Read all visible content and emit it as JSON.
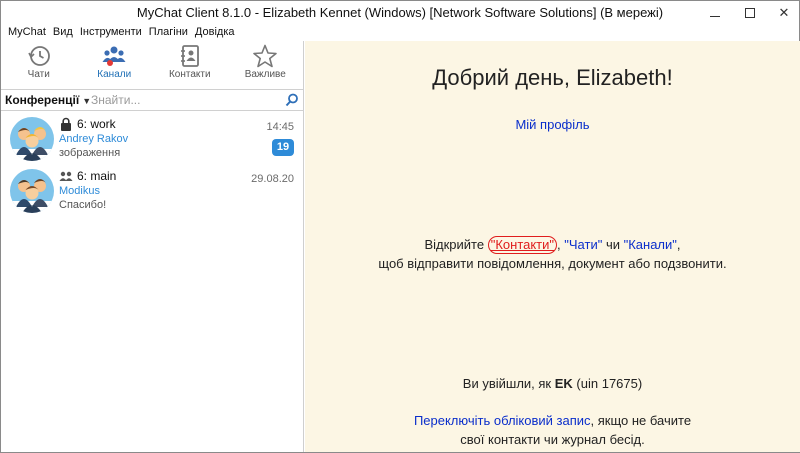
{
  "window": {
    "title": "MyChat Client 8.1.0 - Elizabeth Kennet (Windows) [Network Software Solutions] (В мережі)",
    "minimize_glyph": "—",
    "close_glyph": "✕"
  },
  "menu": [
    "MyChat",
    "Вид",
    "Інструменти",
    "Плагіни",
    "Довідка"
  ],
  "tabs": [
    {
      "label": "Чати",
      "icon": "history-icon",
      "active": false
    },
    {
      "label": "Канали",
      "icon": "channels-icon",
      "active": true
    },
    {
      "label": "Контакти",
      "icon": "contacts-icon",
      "active": false
    },
    {
      "label": "Важливе",
      "icon": "star-icon",
      "active": false
    }
  ],
  "filter": {
    "selected": "Конференції",
    "search_placeholder": "Знайти..."
  },
  "chats": [
    {
      "title": "6: work",
      "author": "Andrey Rakov",
      "message": "зображення",
      "time": "14:45",
      "unread": "19",
      "icon": "lock-icon"
    },
    {
      "title": "6: main",
      "author": "Modikus",
      "message": "Спасибо!",
      "time": "29.08.20",
      "unread": "",
      "icon": "group-icon"
    }
  ],
  "main": {
    "greeting": "Добрий день, Elizabeth!",
    "profile_link": "Мій профіль",
    "hint_prefix": "Відкрийте ",
    "hint_contacts": "\"Контакти\"",
    "hint_sep1": ", ",
    "hint_chats": "\"Чати\"",
    "hint_or": " чи ",
    "hint_channels": "\"Канали\"",
    "hint_suffix": ",",
    "hint_line2": "щоб відправити повідомлення, документ або подзвонити.",
    "login_prefix": "Ви увійшли, як ",
    "login_user": "EK",
    "login_uin": " (uin 17675)",
    "switch_link": "Переключіть обліковий запис",
    "switch_rest": ", якщо не бачите",
    "switch_line2": "свої контакти чи журнал бесід."
  },
  "colors": {
    "accent": "#2e8bd8",
    "link": "#0a2ecb",
    "panel_bg": "#fcf6e4",
    "highlight": "#e01d1d"
  }
}
